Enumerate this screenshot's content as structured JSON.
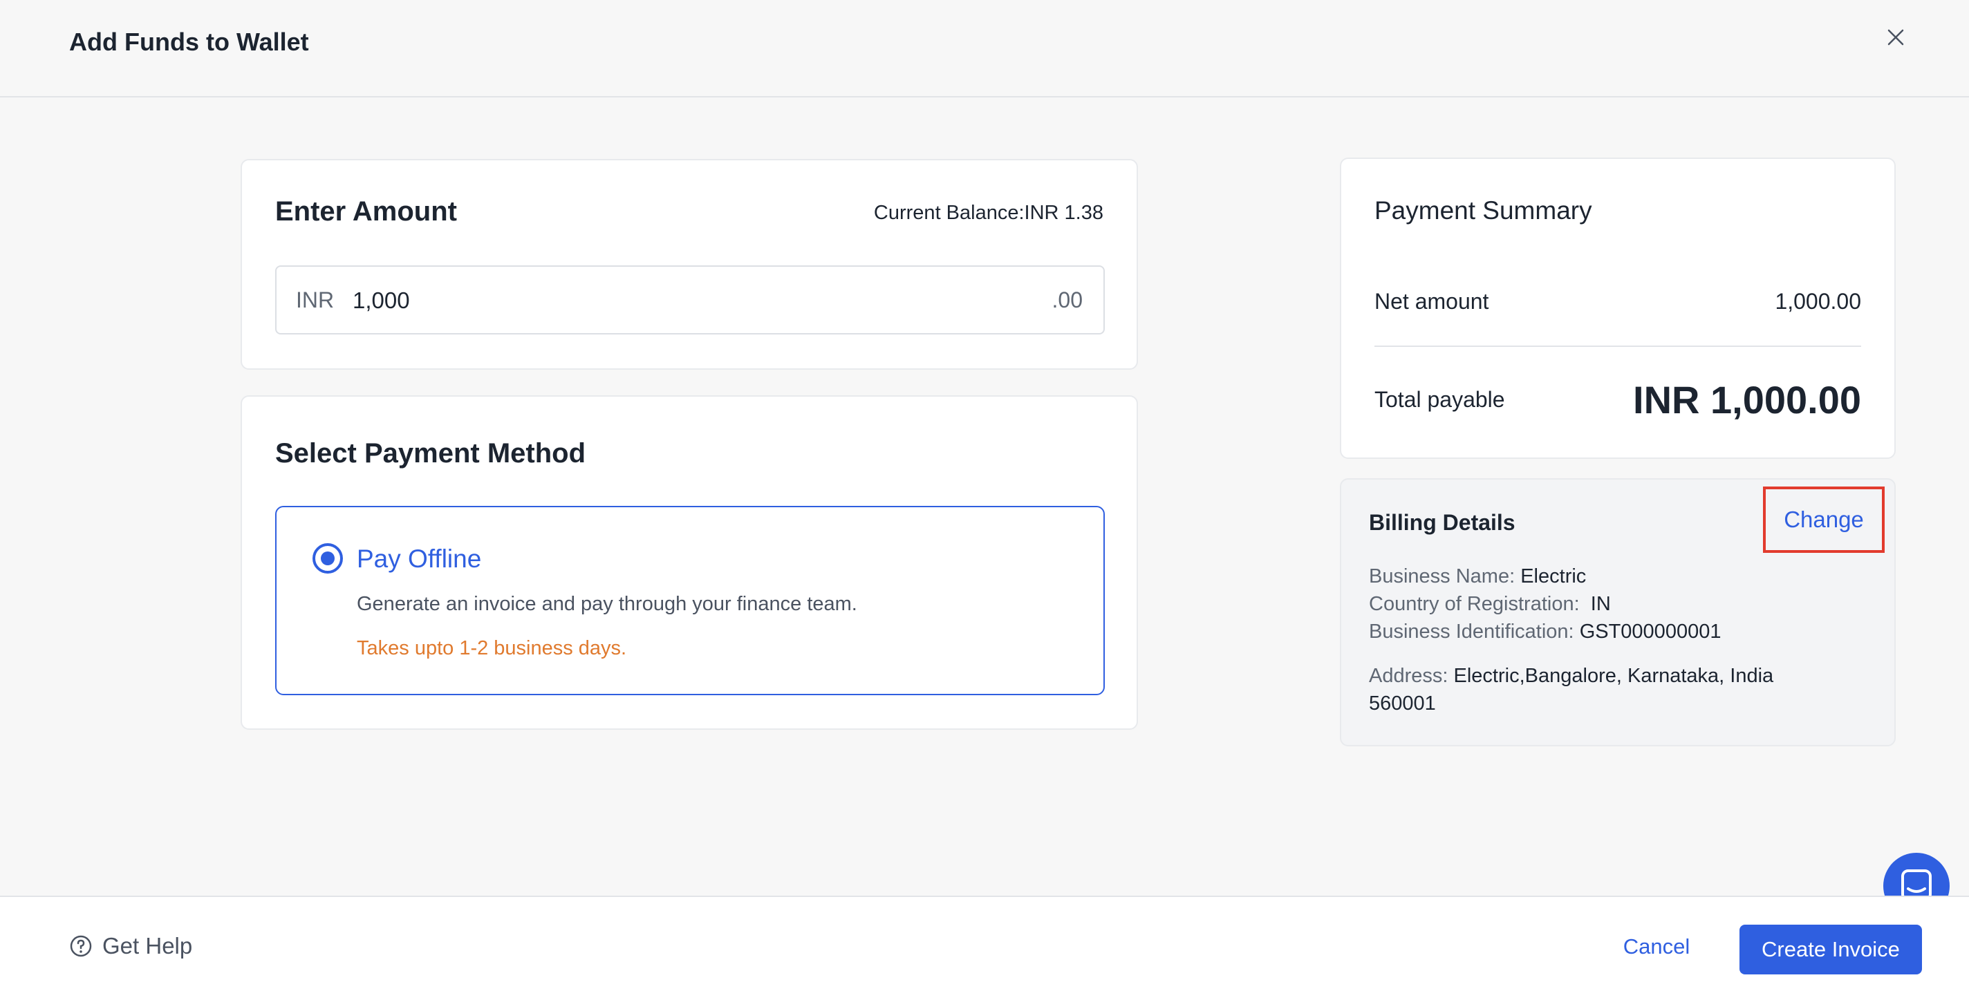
{
  "header": {
    "title": "Add Funds to Wallet"
  },
  "amount": {
    "heading": "Enter Amount",
    "balance_label": "Current Balance:",
    "balance_value": "INR 1.38",
    "currency": "INR",
    "value": "1,000",
    "decimals": ".00"
  },
  "payment_method": {
    "heading": "Select Payment Method",
    "option": {
      "title": "Pay Offline",
      "description": "Generate an invoice and pay through your finance team.",
      "note": "Takes upto 1-2 business days.",
      "selected": true
    }
  },
  "summary": {
    "heading": "Payment Summary",
    "net_label": "Net amount",
    "net_value": "1,000.00",
    "total_label": "Total payable",
    "total_value": "INR 1,000.00"
  },
  "billing": {
    "heading": "Billing Details",
    "change_label": "Change",
    "business_name_label": "Business Name:",
    "business_name": "Electric",
    "country_label": "Country of Registration:",
    "country": "IN",
    "business_id_label": "Business Identification:",
    "business_id": "GST000000001",
    "address_label": "Address:",
    "address_line1": "Electric,Bangalore, Karnataka, India",
    "address_line2": "560001"
  },
  "footer": {
    "help_label": "Get Help",
    "cancel_label": "Cancel",
    "create_label": "Create Invoice"
  },
  "icons": {
    "close": "close-icon",
    "help": "help-circle-icon",
    "chat": "chat-icon"
  },
  "colors": {
    "accent": "#2f5fe0",
    "warning": "#e07a2e",
    "highlight": "#e23b2e"
  }
}
